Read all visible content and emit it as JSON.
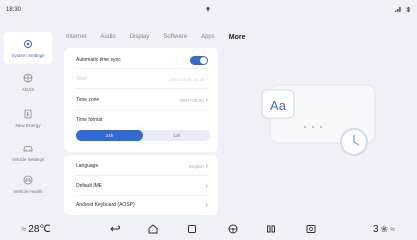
{
  "status_bar": {
    "time": "18:30",
    "center_icon": "temperature-pin-icon",
    "right_icons": [
      "signal-icon",
      "bluetooth-icon"
    ]
  },
  "sidebar": {
    "items": [
      {
        "label": "System Settings",
        "icon": "gear-icon",
        "active": true
      },
      {
        "label": "ADAS",
        "icon": "adas-icon",
        "active": false
      },
      {
        "label": "New Energy",
        "icon": "battery-icon",
        "active": false
      },
      {
        "label": "Vehicle Settings",
        "icon": "car-icon",
        "active": false
      },
      {
        "label": "Vehicle Health",
        "icon": "car-health-icon",
        "active": false
      }
    ]
  },
  "tabs": [
    {
      "label": "Internet",
      "active": false
    },
    {
      "label": "Audio",
      "active": false
    },
    {
      "label": "Display",
      "active": false
    },
    {
      "label": "Software",
      "active": false
    },
    {
      "label": "Apps",
      "active": false
    },
    {
      "label": "More",
      "active": true
    }
  ],
  "settings": {
    "auto_time_sync": {
      "label": "Automatic time sync",
      "enabled": true
    },
    "time": {
      "label": "Time",
      "value": "2023-01-01 18:30"
    },
    "time_zone": {
      "label": "Time zone",
      "value": "GMT+08:00"
    },
    "time_format": {
      "label": "Time format",
      "options": [
        "24h",
        "12h"
      ],
      "selected": "24h"
    },
    "language": {
      "label": "Language",
      "value": "English"
    },
    "default_ime": {
      "label": "Default IME",
      "value": ""
    },
    "android_keyboard": {
      "label": "Android Keyboard (AOSP)",
      "value": ""
    }
  },
  "illustration": {
    "text": "Aa"
  },
  "bottom_bar": {
    "left_temp": "28℃",
    "right_temp": "3",
    "icons": [
      "back-icon",
      "home-icon",
      "recent-apps-icon",
      "steering-icon",
      "apps-grid-icon",
      "media-icon"
    ]
  },
  "colors": {
    "accent": "#2f6bd8",
    "background": "#eef1f5",
    "card": "#ffffff"
  }
}
